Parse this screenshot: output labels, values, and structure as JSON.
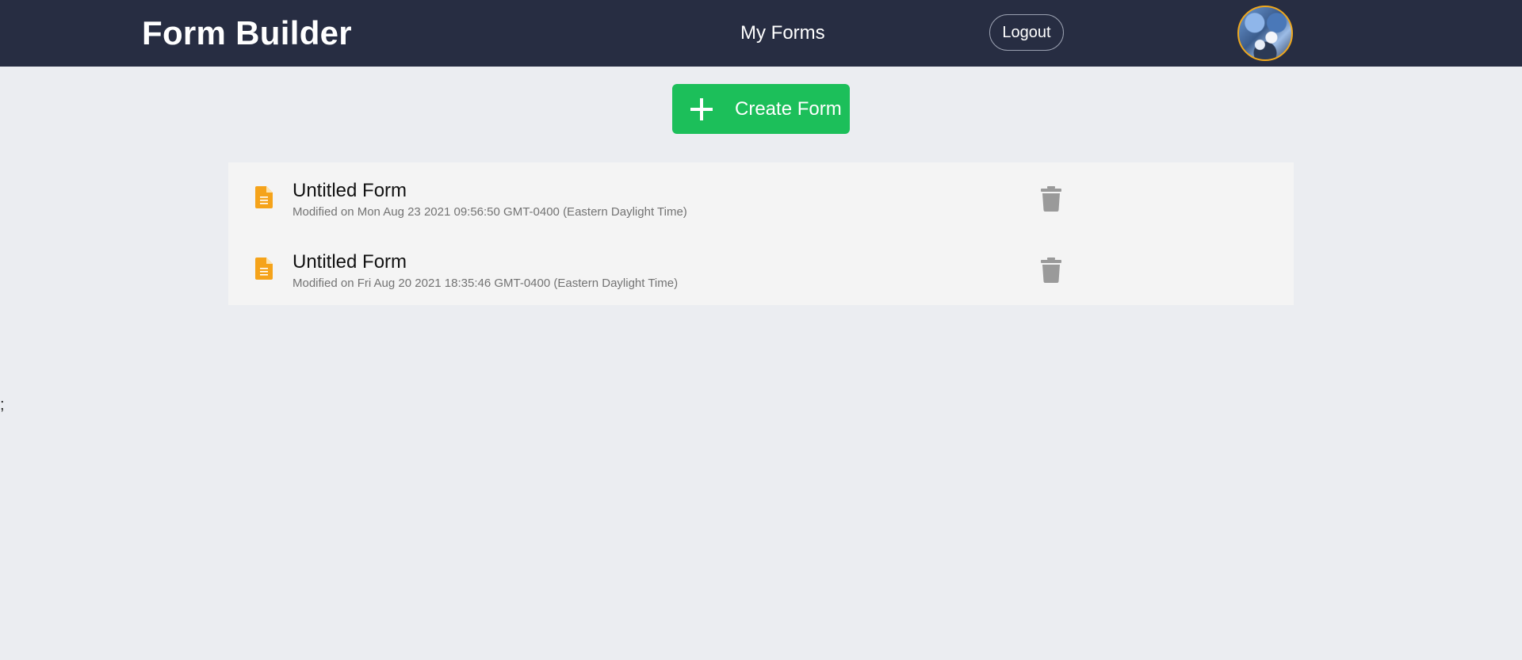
{
  "navbar": {
    "brand": "Form Builder",
    "links": [
      {
        "label": "My Forms"
      }
    ],
    "logout_label": "Logout",
    "avatar_icon": "user-avatar-photo"
  },
  "actions": {
    "create_label": "Create Form",
    "create_icon": "plus-icon"
  },
  "forms": [
    {
      "title": "Untitled Form",
      "modified": "Modified on Mon Aug 23 2021 09:56:50 GMT-0400 (Eastern Daylight Time)",
      "icon": "document-icon",
      "delete_icon": "trash-icon"
    },
    {
      "title": "Untitled Form",
      "modified": "Modified on Fri Aug 20 2021 18:35:46 GMT-0400 (Eastern Daylight Time)",
      "icon": "document-icon",
      "delete_icon": "trash-icon"
    }
  ],
  "stray_text": ";",
  "colors": {
    "navbar_bg": "#272d42",
    "page_bg": "#ebedf1",
    "accent_green": "#1cbf5a",
    "doc_icon": "#f5a31a",
    "avatar_ring": "#f0a81c",
    "trash_icon": "#9a9a9a"
  }
}
